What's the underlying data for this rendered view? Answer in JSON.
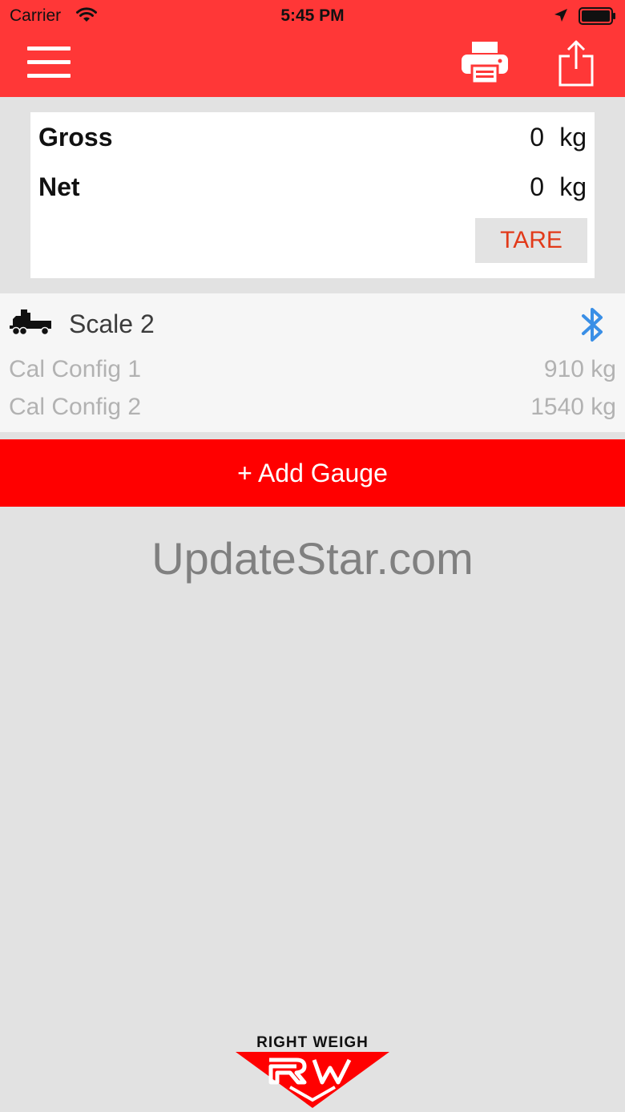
{
  "status_bar": {
    "carrier": "Carrier",
    "time": "5:45 PM"
  },
  "header": {
    "menu_icon": "hamburger-icon",
    "print_icon": "printer-icon",
    "share_icon": "share-icon",
    "background_color": "#ff3737"
  },
  "weights": {
    "gross": {
      "label": "Gross",
      "value": "0",
      "unit": "kg"
    },
    "net": {
      "label": "Net",
      "value": "0",
      "unit": "kg"
    },
    "tare_label": "TARE"
  },
  "scale": {
    "name": "Scale 2",
    "icon": "truck-icon",
    "status_icon": "bluetooth-icon",
    "status_color": "#3a8fe6",
    "configs": [
      {
        "name": "Cal Config 1",
        "value": "910 kg"
      },
      {
        "name": "Cal Config 2",
        "value": "1540 kg"
      }
    ]
  },
  "add_gauge": {
    "label": "+ Add Gauge",
    "color": "#ff0000"
  },
  "watermark": "UpdateStar.com",
  "logo": {
    "text": "RIGHT WEIGH",
    "mark_color": "#ff0000"
  }
}
